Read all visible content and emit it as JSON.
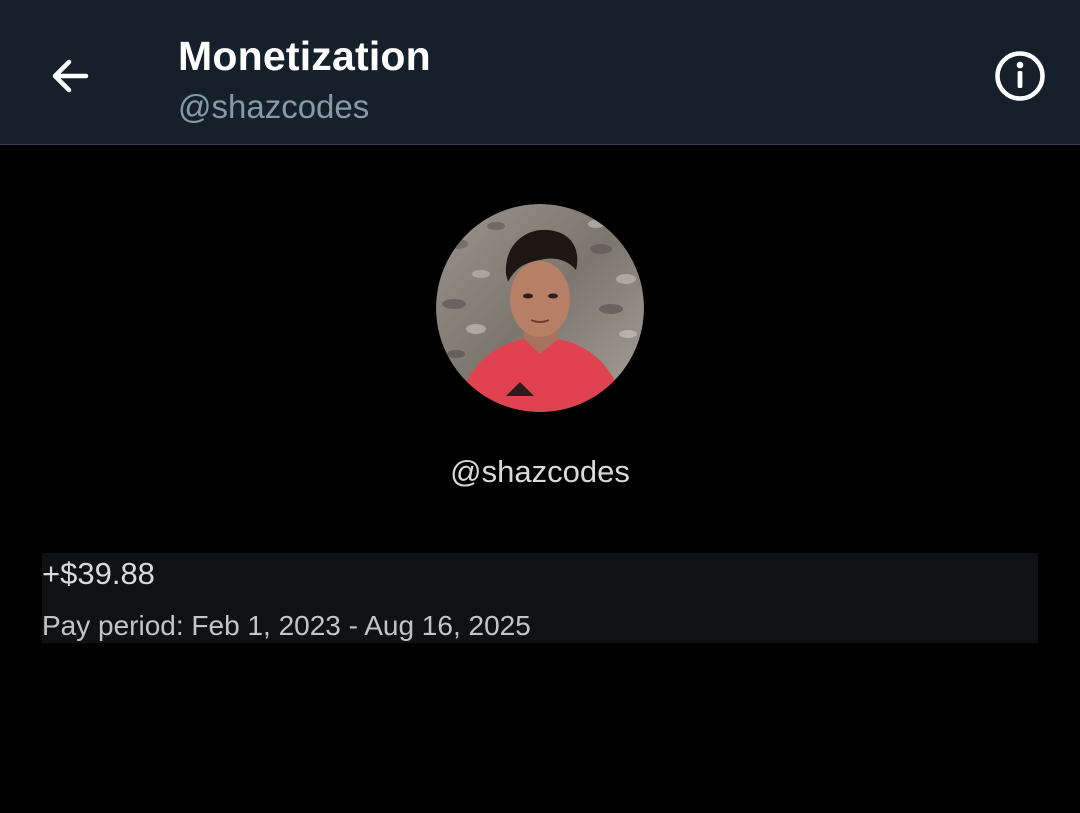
{
  "header": {
    "title": "Monetization",
    "subtitle": "@shazcodes",
    "back_icon": "arrow-left-icon",
    "info_icon": "info-circle-icon"
  },
  "profile": {
    "avatar_alt": "profile photo",
    "handle": "@shazcodes"
  },
  "earnings": {
    "amount": "+$39.88",
    "period": "Pay period: Feb 1, 2023 - Aug 16, 2025"
  },
  "colors": {
    "header_bg": "#15202b",
    "page_bg": "#000000",
    "card_bg": "#101113",
    "subtitle": "#8899a6"
  }
}
